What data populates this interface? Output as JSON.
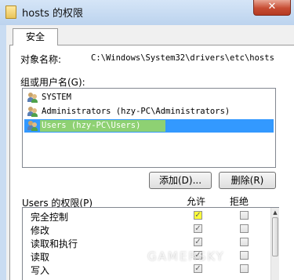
{
  "window": {
    "title": "hosts 的权限",
    "close_label": "✕"
  },
  "tabs": [
    {
      "label": "安全"
    }
  ],
  "object": {
    "label": "对象名称:",
    "path": "C:\\Windows\\System32\\drivers\\etc\\hosts"
  },
  "groups": {
    "label": "组或用户名(G):",
    "items": [
      {
        "name": "SYSTEM",
        "selected": false
      },
      {
        "name": "Administrators (hzy-PC\\Administrators)",
        "selected": false
      },
      {
        "name": "Users (hzy-PC\\Users)",
        "selected": true
      }
    ]
  },
  "buttons": {
    "add": "添加(D)...",
    "remove": "删除(R)"
  },
  "permissions": {
    "title": "Users 的权限(P)",
    "allow_header": "允许",
    "deny_header": "拒绝",
    "rows": [
      {
        "name": "完全控制",
        "allow": true,
        "deny": false
      },
      {
        "name": "修改",
        "allow": true,
        "deny": false
      },
      {
        "name": "读取和执行",
        "allow": true,
        "deny": false
      },
      {
        "name": "读取",
        "allow": true,
        "deny": false
      },
      {
        "name": "写入",
        "allow": true,
        "deny": false
      }
    ]
  },
  "watermark": "GAMERSKY",
  "colors": {
    "selection": "#3399ff",
    "highlight": "#ffff3a",
    "close_button": "#c74d33"
  }
}
